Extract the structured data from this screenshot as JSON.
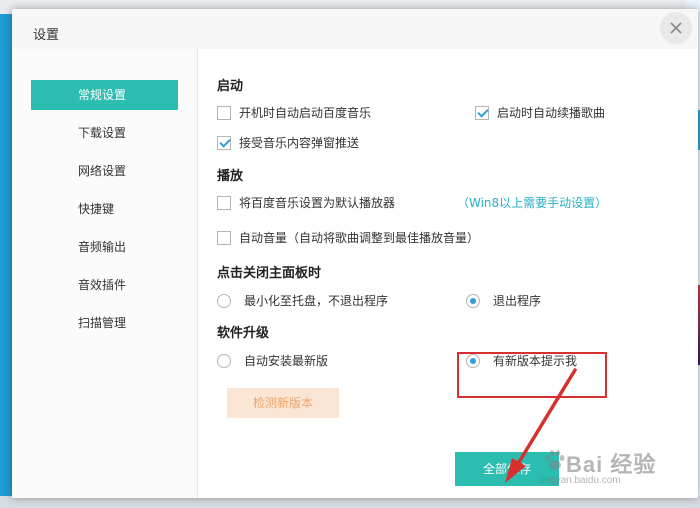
{
  "dialog": {
    "title": "设置",
    "close_icon": "close-icon"
  },
  "sidebar": {
    "items": [
      {
        "label": "常规设置",
        "active": true
      },
      {
        "label": "下载设置",
        "active": false
      },
      {
        "label": "网络设置",
        "active": false
      },
      {
        "label": "快捷键",
        "active": false
      },
      {
        "label": "音频输出",
        "active": false
      },
      {
        "label": "音效插件",
        "active": false
      },
      {
        "label": "扫描管理",
        "active": false
      }
    ]
  },
  "sections": {
    "startup": {
      "title": "启动",
      "auto_start_label": "开机时自动启动百度音乐",
      "auto_start_checked": false,
      "resume_label": "启动时自动续播歌曲",
      "resume_checked": true,
      "popup_label": "接受音乐内容弹窗推送",
      "popup_checked": true
    },
    "playback": {
      "title": "播放",
      "default_player_label": "将百度音乐设置为默认播放器",
      "default_player_checked": false,
      "default_player_hint": "（Win8以上需要手动设置）",
      "auto_volume_label": "自动音量（自动将歌曲调整到最佳播放音量）",
      "auto_volume_checked": false
    },
    "close_panel": {
      "title": "点击关闭主面板时",
      "minimize_label": "最小化至托盘，不退出程序",
      "exit_label": "退出程序",
      "selected": "exit"
    },
    "upgrade": {
      "title": "软件升级",
      "auto_install_label": "自动安装最新版",
      "notify_label": "有新版本提示我",
      "selected": "notify",
      "check_button": "检测新版本"
    }
  },
  "footer": {
    "save_button": "全部保存"
  },
  "watermark": {
    "text": "Bai 经验",
    "sub": "jingyan.baidu.com"
  },
  "colors": {
    "accent": "#2bbdb0",
    "checkmark": "#2f9fe0",
    "hint": "#27b0c3",
    "annotation": "#d8302f"
  }
}
